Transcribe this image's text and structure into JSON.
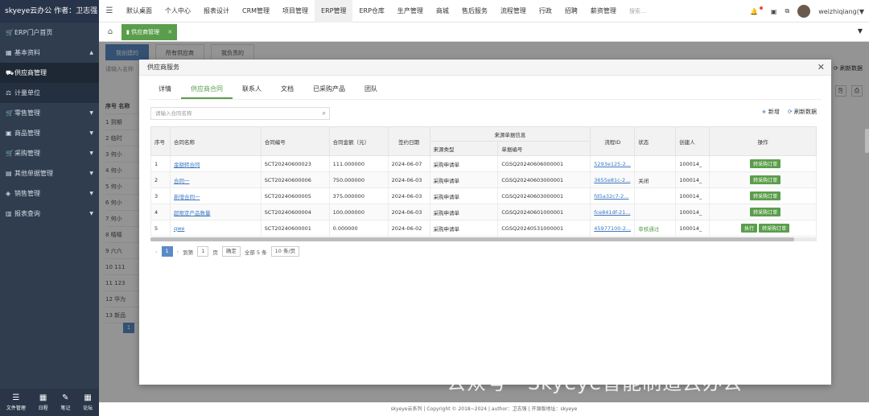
{
  "app": {
    "brand": "skyeye云办公 作者：卫志强"
  },
  "sidebar": {
    "items": [
      {
        "label": "ERP门户首页",
        "icon": "cart-icon",
        "sub": false,
        "arrow": ""
      },
      {
        "label": "基本资料",
        "icon": "grid-icon",
        "sub": false,
        "arrow": "▲"
      },
      {
        "label": "供应商管理",
        "icon": "truck-icon",
        "sub": true,
        "arrow": ""
      },
      {
        "label": "计量单位",
        "icon": "scale-icon",
        "sub": true,
        "arrow": ""
      },
      {
        "label": "零售管理",
        "icon": "cart-icon",
        "sub": false,
        "arrow": "▼"
      },
      {
        "label": "商品管理",
        "icon": "box-icon",
        "sub": false,
        "arrow": "▼"
      },
      {
        "label": "采购管理",
        "icon": "cart-icon",
        "sub": false,
        "arrow": "▼"
      },
      {
        "label": "其他单据管理",
        "icon": "doc-icon",
        "sub": false,
        "arrow": "▼"
      },
      {
        "label": "销售管理",
        "icon": "tag-icon",
        "sub": false,
        "arrow": "▼"
      },
      {
        "label": "报表查询",
        "icon": "chart-icon",
        "sub": false,
        "arrow": "▼"
      }
    ],
    "bottom": [
      {
        "label": "文件管理",
        "icon": "list-icon"
      },
      {
        "label": "日程",
        "icon": "calendar-icon"
      },
      {
        "label": "笔记",
        "icon": "edit-icon"
      },
      {
        "label": "论坛",
        "icon": "forum-icon"
      }
    ]
  },
  "topnav": {
    "items": [
      "默认桌面",
      "个人中心",
      "报表设计",
      "CRM管理",
      "项目管理",
      "ERP管理",
      "ERP仓库",
      "生产管理",
      "商城",
      "售后服务",
      "流程管理",
      "行政",
      "招聘",
      "薪资管理"
    ],
    "active": "ERP管理",
    "search_placeholder": "搜索...",
    "username": "weizhiqiang(▼"
  },
  "tabbar": {
    "tab_label": "供应商管理"
  },
  "background": {
    "subtabs": [
      "我创建的",
      "所有供应商",
      "我负责的"
    ],
    "search_placeholder": "请输入名称",
    "refresh": "刷新数据",
    "rows": [
      "1 到期",
      "2 临时",
      "3 何小",
      "4 何小",
      "5 何小",
      "6 何小",
      "7 何小",
      "8 嘻嘻",
      "9 六六",
      "10 111",
      "11 123",
      "12 华为",
      "13 新品"
    ],
    "header": "序号 名称",
    "page": "1"
  },
  "modal": {
    "title": "供应商服务",
    "tabs": [
      "详情",
      "供应商合同",
      "联系人",
      "文档",
      "已采购产品",
      "团队"
    ],
    "active_tab": "供应商合同",
    "search_placeholder": "请输入合同名称",
    "add_label": "新增",
    "refresh_label": "刷新数据",
    "table": {
      "headers": {
        "no": "序号",
        "name": "合同名称",
        "code": "合同编号",
        "amount": "合同金额（元）",
        "date": "签约日期",
        "source_group": "来源单据信息",
        "source_type": "来源类型",
        "source_no": "单据编号",
        "flow_id": "流程ID",
        "status": "状态",
        "creator": "创建人",
        "ops": "操作"
      },
      "rows": [
        {
          "no": "1",
          "name": "金额转合同",
          "code": "SCT20240600023",
          "amount": "111.000000",
          "date": "2024-06-07",
          "source_type": "采购申请单",
          "source_no": "CGSQ20240606000001",
          "flow_id": "5293e125-2...",
          "status": "",
          "creator": "100014_",
          "ops": [
            "转采购订单"
          ]
        },
        {
          "no": "2",
          "name": "合同一",
          "code": "SCT20240600006",
          "amount": "750.000000",
          "date": "2024-06-03",
          "source_type": "采购申请单",
          "source_no": "CGSQ20240603000001",
          "flow_id": "3655e81c-2...",
          "status": "关闭",
          "creator": "100014_",
          "ops": [
            "转采购订单"
          ]
        },
        {
          "no": "3",
          "name": "新增合同一",
          "code": "SCT20240600005",
          "amount": "375.000000",
          "date": "2024-06-03",
          "source_type": "采购申请单",
          "source_no": "CGSQ20240603000001",
          "flow_id": "fd5a32c7-2...",
          "status": "",
          "creator": "100014_",
          "ops": [
            "转采购订单"
          ]
        },
        {
          "no": "4",
          "name": "超限定产品数量",
          "code": "SCT20240600004",
          "amount": "100.000000",
          "date": "2024-06-03",
          "source_type": "采购申请单",
          "source_no": "CGSQ20240601000001",
          "flow_id": "fce841df-21...",
          "status": "",
          "creator": "100014_",
          "ops": [
            "转采购订单"
          ]
        },
        {
          "no": "5",
          "name": "qwe",
          "code": "SCT20240600001",
          "amount": "0.000000",
          "date": "2024-06-02",
          "source_type": "采购申请单",
          "source_no": "CGSQ20240531000001",
          "flow_id": "45977100-2...",
          "status": "审核通过",
          "creator": "100014_",
          "ops": [
            "执行",
            "转采购订单"
          ]
        }
      ]
    },
    "pager": {
      "page": "1",
      "goto_prefix": "到第",
      "goto_value": "1",
      "goto_suffix": "页",
      "confirm": "确定",
      "total": "全部 5 条",
      "per_page": "10 条/页"
    }
  },
  "footer": {
    "text": "skyeye云系列 | Copyright © 2018~2024 | author：卫志强 | 开源版地址：skyeye"
  },
  "watermark": {
    "text": "公众号 · Skyeye智能制造云办公"
  }
}
